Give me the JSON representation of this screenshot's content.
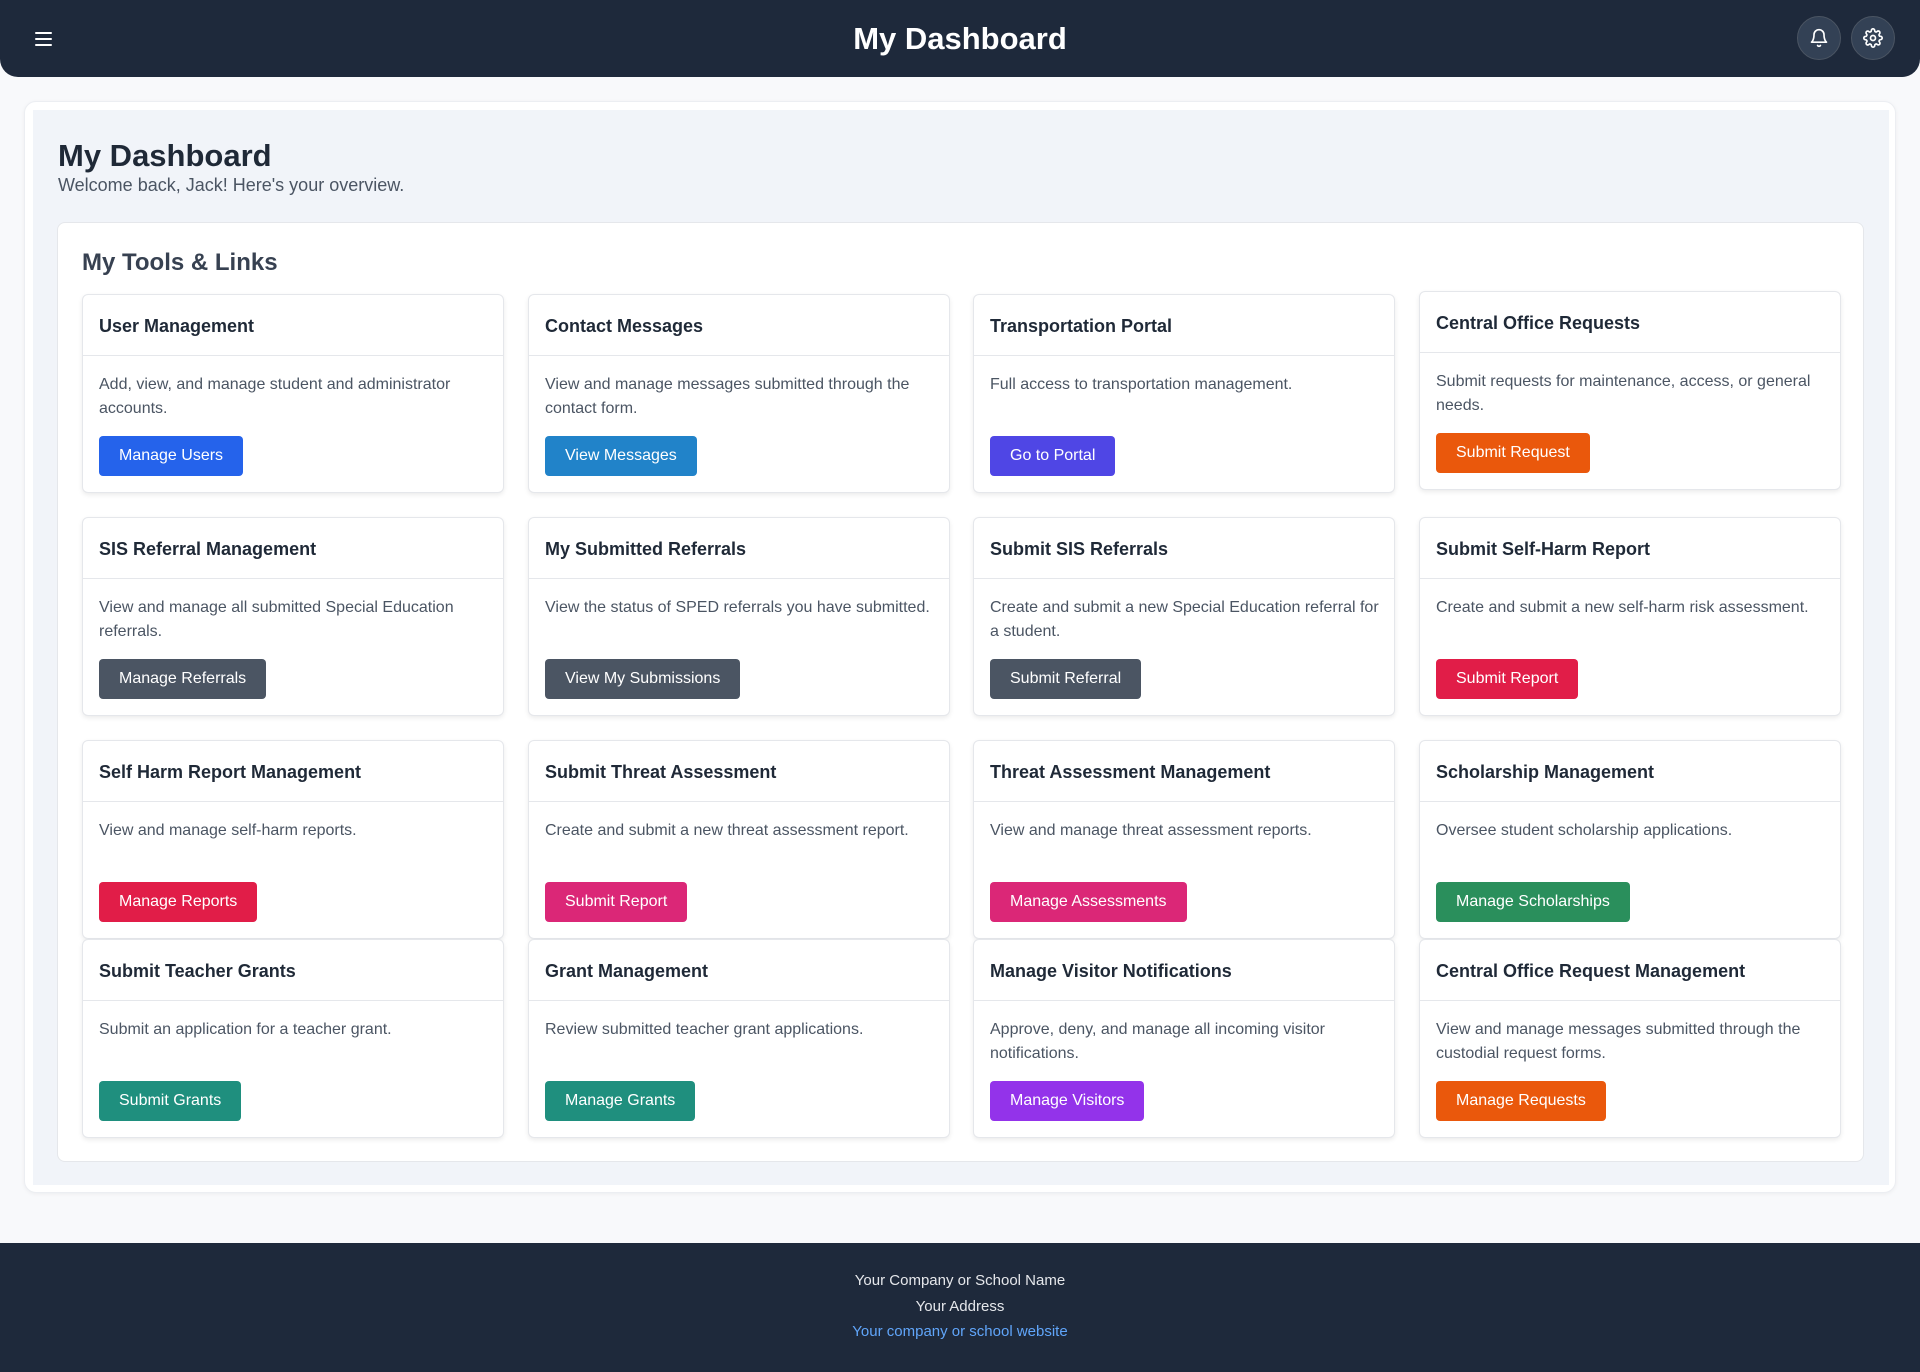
{
  "header": {
    "title": "My Dashboard",
    "menu_icon": "hamburger-menu-icon",
    "notifications_icon": "bell-icon",
    "settings_icon": "gear-icon"
  },
  "page": {
    "title": "My Dashboard",
    "subtitle": "Welcome back, Jack! Here's your overview."
  },
  "tools": {
    "heading": "My Tools & Links",
    "cards": [
      {
        "title": "User Management",
        "description": "Add, view, and manage student and administrator accounts.",
        "button": "Manage Users",
        "color": "#2563eb"
      },
      {
        "title": "Contact Messages",
        "description": "View and manage messages submitted through the contact form.",
        "button": "View Messages",
        "color": "#2183c9"
      },
      {
        "title": "Transportation Portal",
        "description": "Full access to transportation management.",
        "button": "Go to Portal",
        "color": "#4f46e5"
      },
      {
        "title": "Central Office Requests",
        "description": "Submit requests for maintenance, access, or general needs.",
        "button": "Submit Request",
        "color": "#ea580c"
      },
      {
        "title": "SIS Referral Management",
        "description": "View and manage all submitted Special Education referrals.",
        "button": "Manage Referrals",
        "color": "#4b5563"
      },
      {
        "title": "My Submitted Referrals",
        "description": "View the status of SPED referrals you have submitted.",
        "button": "View My Submissions",
        "color": "#4b5563"
      },
      {
        "title": "Submit SIS Referrals",
        "description": "Create and submit a new Special Education referral for a student.",
        "button": "Submit Referral",
        "color": "#4b5563"
      },
      {
        "title": "Submit Self-Harm Report",
        "description": "Create and submit a new self-harm risk assessment.",
        "button": "Submit Report",
        "color": "#e11d48"
      },
      {
        "title": "Self Harm Report Management",
        "description": "View and manage self-harm reports.",
        "button": "Manage Reports",
        "color": "#e11d48"
      },
      {
        "title": "Submit Threat Assessment",
        "description": "Create and submit a new threat assessment report.",
        "button": "Submit Report",
        "color": "#db2777"
      },
      {
        "title": "Threat Assessment Management",
        "description": "View and manage threat assessment reports.",
        "button": "Manage Assessments",
        "color": "#db2777"
      },
      {
        "title": "Scholarship Management",
        "description": "Oversee student scholarship applications.",
        "button": "Manage Scholarships",
        "color": "#2a8f5c"
      },
      {
        "title": "Submit Teacher Grants",
        "description": "Submit an application for a teacher grant.",
        "button": "Submit Grants",
        "color": "#1f8f7e"
      },
      {
        "title": "Grant Management",
        "description": "Review submitted teacher grant applications.",
        "button": "Manage Grants",
        "color": "#1f8f7e"
      },
      {
        "title": "Manage Visitor Notifications",
        "description": "Approve, deny, and manage all incoming visitor notifications.",
        "button": "Manage Visitors",
        "color": "#9333ea"
      },
      {
        "title": "Central Office Request Management",
        "description": "View and manage messages submitted through the custodial request forms.",
        "button": "Manage Requests",
        "color": "#ea580c"
      }
    ]
  },
  "footer": {
    "line1": "Your Company or School Name",
    "line2": "Your Address",
    "link": "Your company or school website"
  }
}
